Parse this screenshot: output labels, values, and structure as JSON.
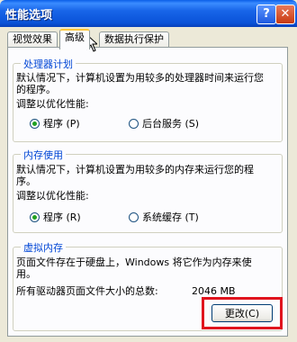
{
  "window": {
    "title": "性能选项",
    "help_glyph": "?",
    "close_glyph": "✕"
  },
  "tabs": [
    {
      "label": "视觉效果",
      "active": false
    },
    {
      "label": "高级",
      "active": true
    },
    {
      "label": "数据执行保护",
      "active": false
    }
  ],
  "processor": {
    "legend": "处理器计划",
    "description": "默认情况下，计算机设置为用较多的处理器时间来运行您的程序。",
    "adjust_label": "调整以优化性能:",
    "options": [
      {
        "label": "程序 (P)",
        "selected": true
      },
      {
        "label": "后台服务 (S)",
        "selected": false
      }
    ]
  },
  "memory": {
    "legend": "内存使用",
    "description": "默认情况下，计算机设置为用较多的内存来运行您的程序。",
    "adjust_label": "调整以优化性能:",
    "options": [
      {
        "label": "程序 (R)",
        "selected": true
      },
      {
        "label": "系统缓存 (T)",
        "selected": false
      }
    ]
  },
  "virtual_memory": {
    "legend": "虚拟内存",
    "description": "页面文件存在于硬盘上，Windows 将它作为内存来使用。",
    "total_label": "所有驱动器页面文件大小的总数:",
    "total_value": "2046 MB",
    "change_button": "更改(C)"
  },
  "colors": {
    "title_bar": "#0a52d8",
    "legend_text": "#0046d5",
    "highlight": "#e0141e"
  }
}
